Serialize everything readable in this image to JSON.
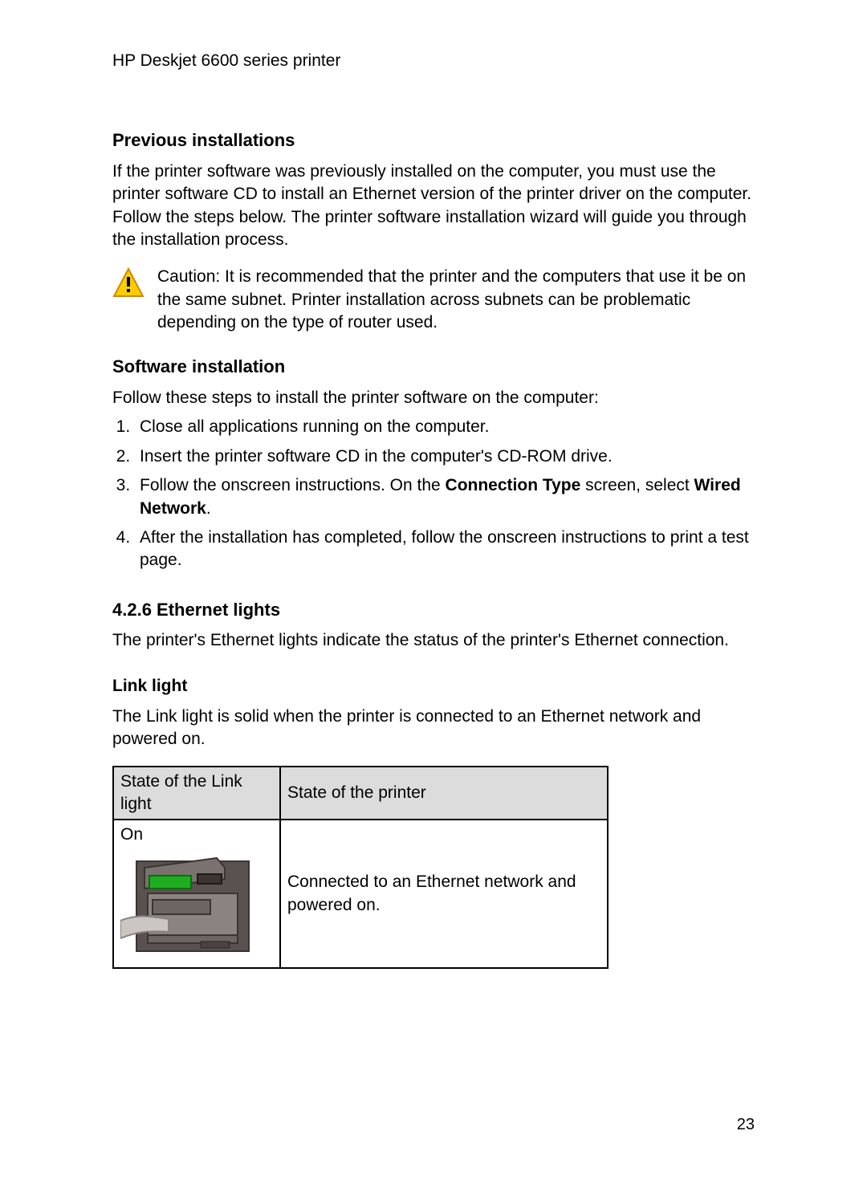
{
  "header": "HP Deskjet 6600 series printer",
  "sections": {
    "prev": {
      "title": "Previous installations",
      "body": "If the printer software was previously installed on the computer, you must use the printer software CD to install an Ethernet version of the printer driver on the computer. Follow the steps below. The printer software installation wizard will guide you through the installation process."
    },
    "caution": {
      "text": "Caution: It is recommended that the printer and the computers that use it be on the same subnet. Printer installation across subnets can be problematic depending on the type of router used."
    },
    "software": {
      "title": "Software installation",
      "intro": "Follow these steps to install the printer software on the computer:",
      "steps": [
        "Close all applications running on the computer.",
        "Insert the printer software CD in the computer's CD-ROM drive.",
        {
          "pre": "Follow the onscreen instructions. On the ",
          "b1": "Connection Type",
          "mid": " screen, select ",
          "b2": "Wired Network",
          "post": "."
        },
        "After the installation has completed, follow the onscreen instructions to print a test page."
      ]
    },
    "ethernet": {
      "title": "4.2.6  Ethernet lights",
      "body": "The printer's Ethernet lights indicate the status of the printer's Ethernet connection."
    },
    "linklight": {
      "title": "Link light",
      "body": "The Link light is solid when the printer is connected to an Ethernet network and powered on.",
      "table": {
        "h1": "State of the Link light",
        "h2": "State of the printer",
        "r1c1": "On",
        "r1c2": "Connected to an Ethernet network and powered on."
      }
    }
  },
  "page_number": "23"
}
